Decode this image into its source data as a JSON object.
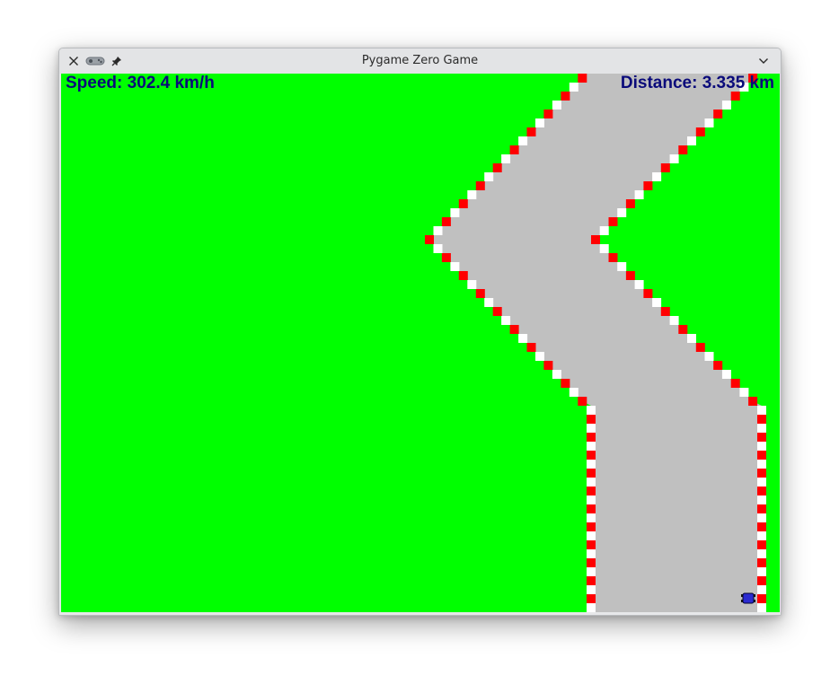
{
  "window": {
    "title": "Pygame Zero Game"
  },
  "titlebar_icons": {
    "close": "close-icon",
    "app": "gamepad-icon",
    "pin": "pin-icon",
    "menu": "chevron-down-icon"
  },
  "hud": {
    "speed": "Speed: 302.4 km/h",
    "distance": "Distance: 3.335 km"
  },
  "colors": {
    "grass": "#00ff00",
    "road": "#c0c0c0",
    "kerb_red": "#ff0000",
    "kerb_white": "#ffffff",
    "hud_text": "#0a0a7a",
    "car": "#2b2bd0"
  }
}
